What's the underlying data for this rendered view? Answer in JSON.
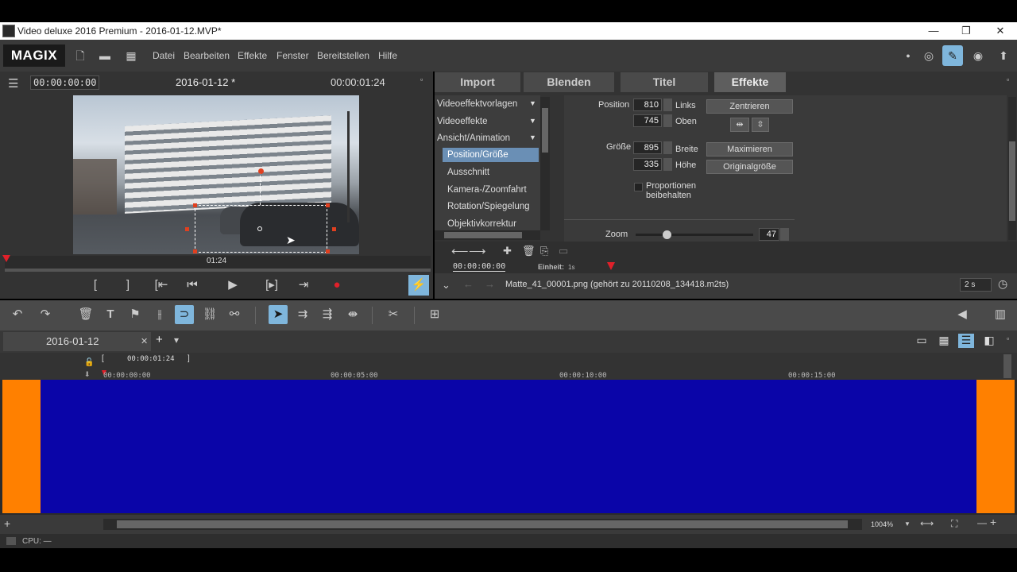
{
  "window": {
    "title": "Video deluxe 2016 Premium - 2016-01-12.MVP*",
    "minimize": "—",
    "restore": "❐",
    "close": "✕"
  },
  "menubar": {
    "logo": "MAGIX",
    "items": [
      "Datei",
      "Bearbeiten",
      "Effekte",
      "Fenster",
      "Bereitstellen",
      "Hilfe"
    ]
  },
  "preview": {
    "timecode_left": "00:00:00:00",
    "project_name": "2016-01-12 *",
    "timecode_right": "00:00:01:24",
    "position_label": "01:24"
  },
  "transport": {
    "mark_in": "[",
    "mark_out": "]",
    "prev_marker": "[⇤",
    "prev": "⏮",
    "play": "▶",
    "next_marker": "[▸]",
    "next": "⇥",
    "record": "●",
    "lightning": "⚡"
  },
  "mediapool": {
    "tabs": [
      "Import",
      "Blenden",
      "Titel",
      "Effekte"
    ],
    "active_tab": "Effekte",
    "categories": [
      {
        "label": "Videoeffektvorlagen",
        "arrow": "▼"
      },
      {
        "label": "Videoeffekte",
        "arrow": "▼"
      },
      {
        "label": "Ansicht/Animation",
        "arrow": "▼"
      }
    ],
    "subitems": [
      "Position/Größe",
      "Ausschnitt",
      "Kamera-/Zoomfahrt",
      "Rotation/Spiegelung",
      "Objektivkorrektur"
    ],
    "selected_subitem": "Position/Größe",
    "position": {
      "label": "Position",
      "x_value": "810",
      "x_label": "Links",
      "y_value": "745",
      "y_label": "Oben",
      "center_button": "Zentrieren"
    },
    "size": {
      "label": "Größe",
      "w_value": "895",
      "w_label": "Breite",
      "h_value": "335",
      "h_label": "Höhe",
      "max_button": "Maximieren",
      "orig_button": "Originalgröße"
    },
    "keep_proportions": "Proportionen beibehalten",
    "zoom_label": "Zoom",
    "zoom_value": "47",
    "kf_timecode": "00:00:00:00",
    "unit_label": "Einheit:",
    "unit_value": "1s",
    "file_info": "Matte_41_00001.png (gehört zu 20110208_134418.m2ts)",
    "duration": "2 s"
  },
  "timeline": {
    "project_tab": "2016-01-12",
    "close": "✕",
    "add": "+",
    "dropdown": "▾",
    "range_start": "[",
    "range_duration": "00:00:01:24",
    "range_end": "]",
    "ruler": [
      "00:00:00:00",
      "00:00:05:00",
      "00:00:10:00",
      "00:00:15:00"
    ],
    "zoom_percent": "1004%",
    "add_track": "+",
    "zoom_minus": "—",
    "zoom_plus": "+"
  },
  "status": {
    "cpu": "CPU: —"
  },
  "colors": {
    "clip_main": "#0a05a8",
    "clip_edge": "#ff8000",
    "accent": "#7fb6dc",
    "record": "#e0202a"
  }
}
